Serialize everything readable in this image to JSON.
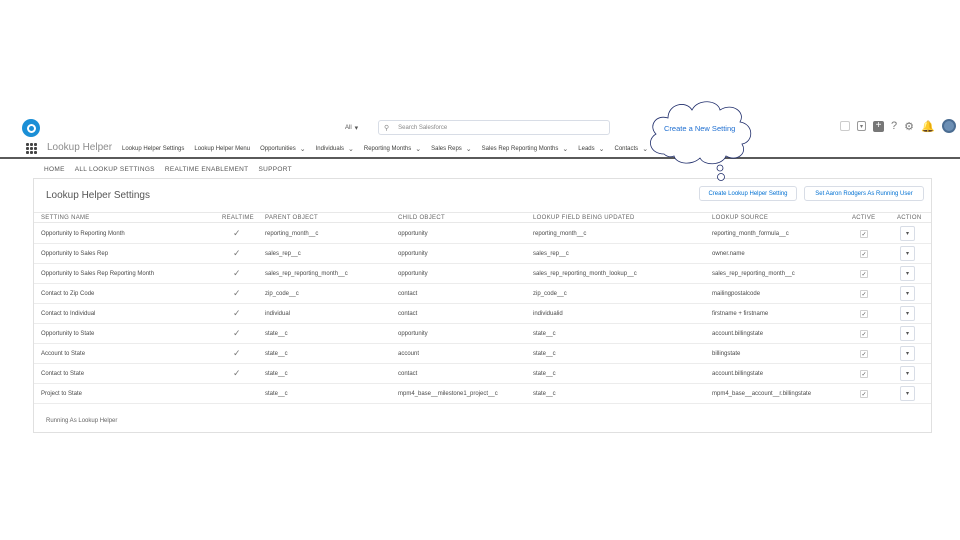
{
  "header": {
    "search_scope": "All",
    "search_placeholder": "Search Salesforce"
  },
  "nav": {
    "app_name": "Lookup Helper",
    "items": [
      {
        "label": "Lookup Helper Settings",
        "dropdown": false
      },
      {
        "label": "Lookup Helper Menu",
        "dropdown": false
      },
      {
        "label": "Opportunities",
        "dropdown": true
      },
      {
        "label": "Individuals",
        "dropdown": true
      },
      {
        "label": "Reporting Months",
        "dropdown": true
      },
      {
        "label": "Sales Reps",
        "dropdown": true
      },
      {
        "label": "Sales Rep Reporting Months",
        "dropdown": true
      },
      {
        "label": "Leads",
        "dropdown": true
      },
      {
        "label": "Contacts",
        "dropdown": true
      }
    ]
  },
  "tabs": [
    "HOME",
    "ALL LOOKUP SETTINGS",
    "REALTIME ENABLEMENT",
    "SUPPORT"
  ],
  "panel": {
    "title": "Lookup Helper Settings",
    "create_button": "Create Lookup Helper Setting",
    "running_user_button": "Set Aaron Rodgers As Running User",
    "footer": "Running As Lookup Helper"
  },
  "table": {
    "columns": [
      "SETTING NAME",
      "REALTIME",
      "PARENT OBJECT",
      "CHILD OBJECT",
      "LOOKUP FIELD BEING UPDATED",
      "LOOKUP SOURCE",
      "ACTIVE",
      "ACTION"
    ],
    "rows": [
      {
        "name": "Opportunity to Reporting Month",
        "realtime": true,
        "parent": "reporting_month__c",
        "child": "opportunity",
        "field": "reporting_month__c",
        "source": "reporting_month_formula__c",
        "active": true
      },
      {
        "name": "Opportunity to Sales Rep",
        "realtime": true,
        "parent": "sales_rep__c",
        "child": "opportunity",
        "field": "sales_rep__c",
        "source": "owner.name",
        "active": true
      },
      {
        "name": "Opportunity to Sales Rep Reporting Month",
        "realtime": true,
        "parent": "sales_rep_reporting_month__c",
        "child": "opportunity",
        "field": "sales_rep_reporting_month_lookup__c",
        "source": "sales_rep_reporting_month__c",
        "active": true
      },
      {
        "name": "Contact to Zip Code",
        "realtime": true,
        "parent": "zip_code__c",
        "child": "contact",
        "field": "zip_code__c",
        "source": "mailingpostalcode",
        "active": true
      },
      {
        "name": "Contact to Individual",
        "realtime": true,
        "parent": "individual",
        "child": "contact",
        "field": "individualid",
        "source": "firstname + firstname",
        "active": true
      },
      {
        "name": "Opportunity to State",
        "realtime": true,
        "parent": "state__c",
        "child": "opportunity",
        "field": "state__c",
        "source": "account.billingstate",
        "active": true
      },
      {
        "name": "Account to State",
        "realtime": true,
        "parent": "state__c",
        "child": "account",
        "field": "state__c",
        "source": "billingstate",
        "active": true
      },
      {
        "name": "Contact to State",
        "realtime": true,
        "parent": "state__c",
        "child": "contact",
        "field": "state__c",
        "source": "account.billingstate",
        "active": true
      },
      {
        "name": "Project to State",
        "realtime": false,
        "parent": "state__c",
        "child": "mpm4_base__milestone1_project__c",
        "field": "state__c",
        "source": "mpm4_base__account__r.billingstate",
        "active": true
      }
    ]
  },
  "annotation": {
    "label": "Create a New Setting"
  },
  "colors": {
    "accent": "#0070d2",
    "logo": "#1b8fd6",
    "annotation": "#1f6fd1"
  }
}
